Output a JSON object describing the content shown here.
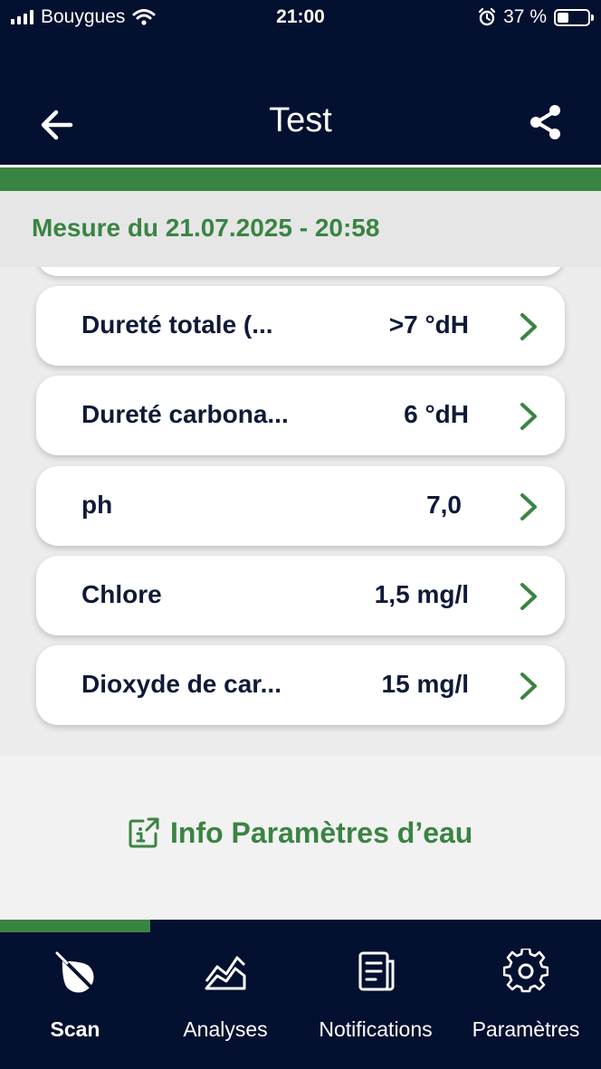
{
  "status": {
    "carrier": "Bouygues",
    "time": "21:00",
    "battery_text": "37 %",
    "battery_level": 0.37
  },
  "header": {
    "title": "Test"
  },
  "measure": {
    "title": "Mesure du 21.07.2025 - 20:58"
  },
  "parameters": [
    {
      "name": "Dureté totale (...",
      "value": ">7 °dH"
    },
    {
      "name": "Dureté carbona...",
      "value": "6 °dH"
    },
    {
      "name": "ph",
      "value": "7,0"
    },
    {
      "name": "Chlore",
      "value": "1,5 mg/l"
    },
    {
      "name": "Dioxyde de car...",
      "value": "15 mg/l"
    }
  ],
  "info_link": {
    "label": "Info Paramètres d’eau"
  },
  "tabs": [
    {
      "label": "Scan",
      "icon": "scan-drop-icon",
      "active": true
    },
    {
      "label": "Analyses",
      "icon": "chart-icon",
      "active": false
    },
    {
      "label": "Notifications",
      "icon": "notifications-icon",
      "active": false
    },
    {
      "label": "Paramètres",
      "icon": "gear-icon",
      "active": false
    }
  ],
  "colors": {
    "navy": "#03102f",
    "green": "#3a8443",
    "text_dark": "#0f1a38"
  }
}
